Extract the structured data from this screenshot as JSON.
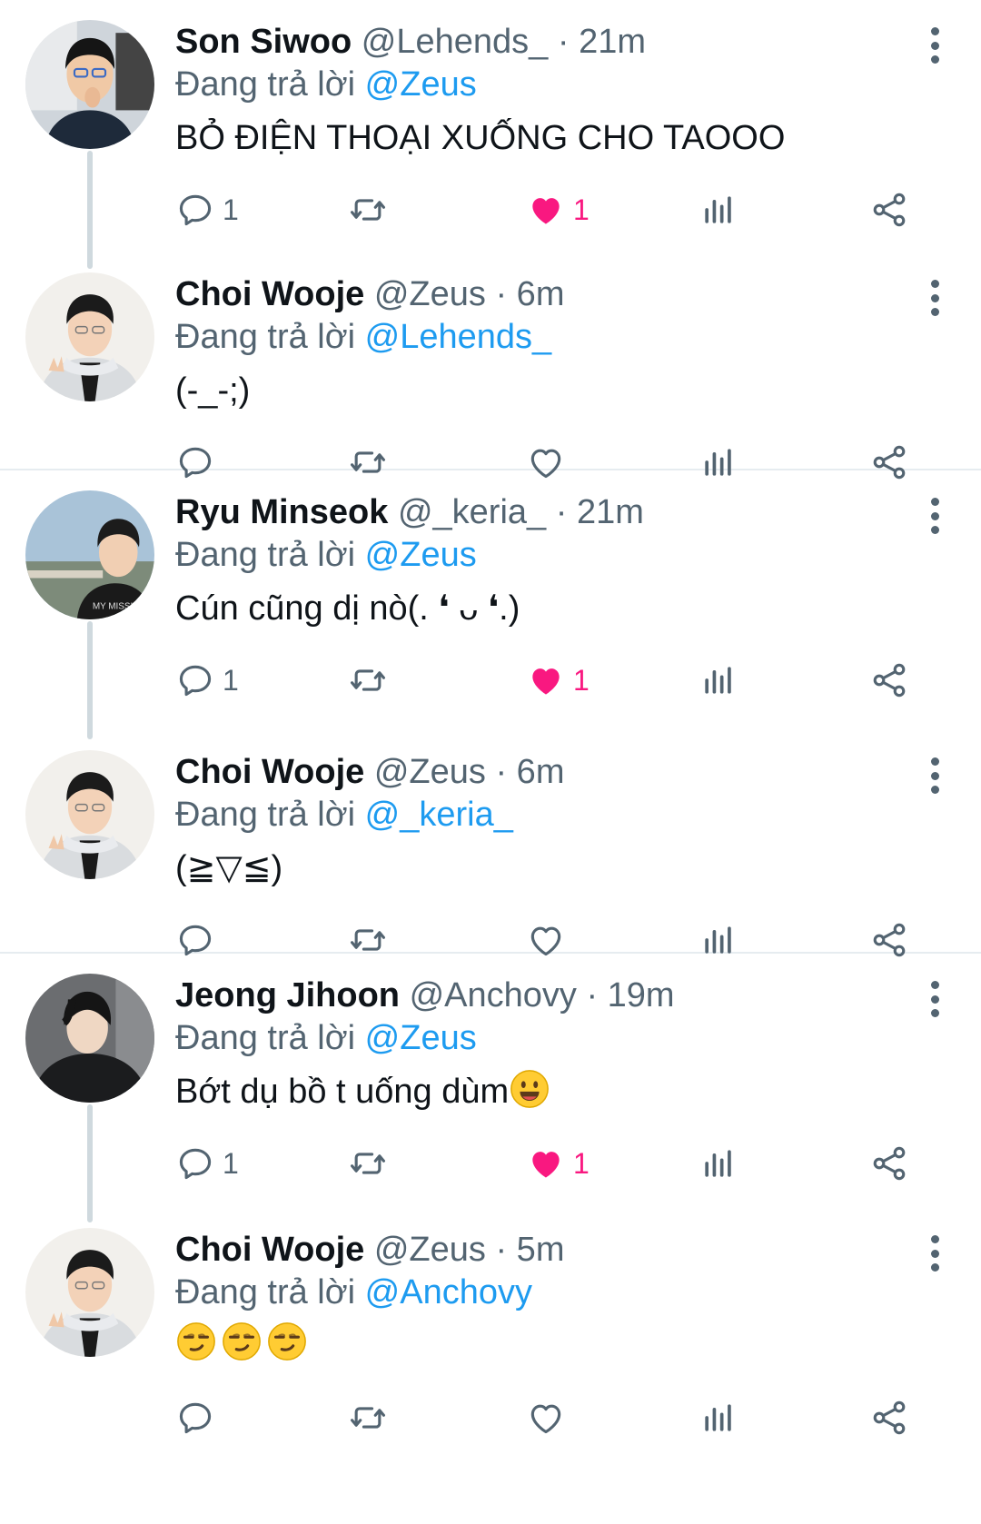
{
  "reply_prefix": "Đang trả lời",
  "threads": [
    {
      "parent": {
        "name": "Son Siwoo",
        "handle": "@Lehends_",
        "time": "· 21m",
        "mention": "@Zeus",
        "text": "BỎ ĐIỆN THOẠI XUỐNG CHO TAOOO",
        "reply_count": "1",
        "like_count": "1"
      },
      "reply": {
        "name": "Choi Wooje",
        "handle": "@Zeus",
        "time": "· 6m",
        "mention": "@Lehends_",
        "text": "(-_-;)"
      }
    },
    {
      "parent": {
        "name": "Ryu Minseok",
        "handle": "@_keria_",
        "time": "· 21m",
        "mention": "@Zeus",
        "text": "Cún cũng dị nò(. ❛ ᴗ ❛.)",
        "reply_count": "1",
        "like_count": "1"
      },
      "reply": {
        "name": "Choi Wooje",
        "handle": "@Zeus",
        "time": "· 6m",
        "mention": "@_keria_",
        "text": "(≧▽≦)"
      }
    },
    {
      "parent": {
        "name": "Jeong Jihoon",
        "handle": "@Anchovy",
        "time": "· 19m",
        "mention": "@Zeus",
        "text": "Bớt dụ bồ t uống dùm",
        "reply_count": "1",
        "like_count": "1"
      },
      "reply": {
        "name": "Choi Wooje",
        "handle": "@Zeus",
        "time": "· 5m",
        "mention": "@Anchovy",
        "text": ""
      }
    }
  ],
  "icons": {
    "reply": "reply-icon",
    "retweet": "retweet-icon",
    "like": "heart-icon",
    "views": "views-icon",
    "share": "share-icon",
    "more": "more-icon"
  },
  "colors": {
    "mention": "#1d9bf0",
    "like": "#f91880",
    "muted": "#536471"
  }
}
